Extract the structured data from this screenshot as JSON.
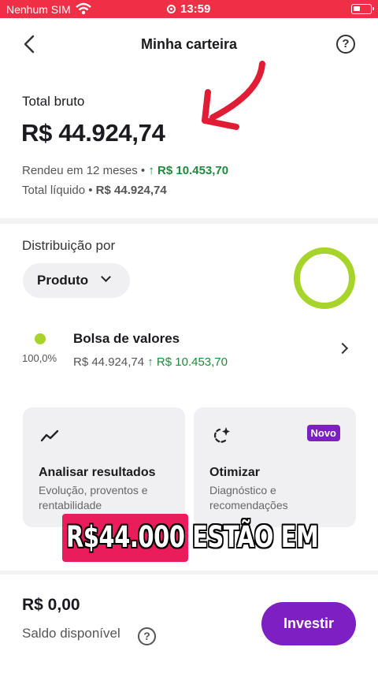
{
  "status_bar": {
    "carrier": "Nenhum SIM",
    "time": "13:59"
  },
  "header": {
    "title": "Minha carteira",
    "help_icon_label": "?"
  },
  "summary": {
    "total_label": "Total bruto",
    "total_value": "R$ 44.924,74",
    "rendeu_label": "Rendeu em 12 meses",
    "rendeu_separator": "•",
    "rendeu_value": "R$ 10.453,70",
    "liquido_label": "Total líquido",
    "liquido_separator": "•",
    "liquido_value": "R$ 44.924,74"
  },
  "distribution": {
    "label": "Distribuição por",
    "selector_value": "Produto",
    "items": [
      {
        "name": "Bolsa de valores",
        "percent": "100,0%",
        "value": "R$ 44.924,74",
        "gain": "R$ 10.453,70",
        "color": "#a6d42a"
      }
    ]
  },
  "features": [
    {
      "title": "Analisar resultados",
      "description": "Evolução, proventos e rentabilidade",
      "icon": "chart-trend-icon"
    },
    {
      "title": "Otimizar",
      "description": "Diagnóstico e recomendações",
      "icon": "sparkle-refresh-icon",
      "badge": "Novo"
    }
  ],
  "balance": {
    "value": "R$ 0,00",
    "label": "Saldo disponível",
    "help_icon_label": "?"
  },
  "actions": {
    "invest_label": "Investir"
  },
  "overlay": {
    "caption": "R$44.000 ESTÃO EM"
  },
  "colors": {
    "accent_purple": "#7d1fc2",
    "positive_green": "#1f8a3a",
    "status_bar_red": "#ef2f46",
    "annotation_red": "#e01d35"
  }
}
